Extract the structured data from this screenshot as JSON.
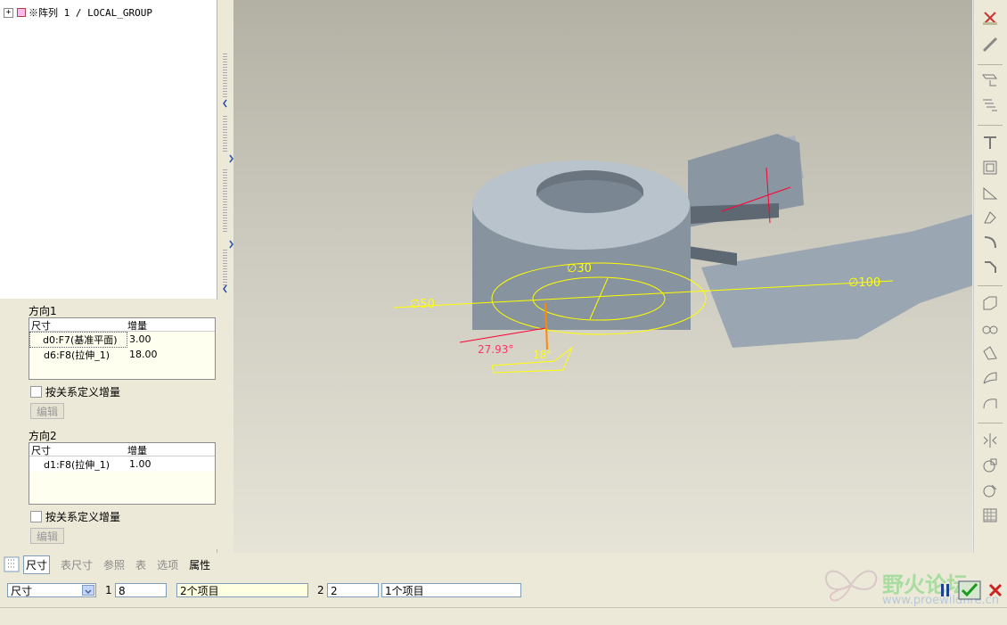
{
  "tree": {
    "items": [
      {
        "label": "※阵列 1 / LOCAL_GROUP"
      }
    ]
  },
  "panel": {
    "direction1": {
      "label": "方向1",
      "col_dim": "尺寸",
      "col_inc": "增量",
      "rows": [
        {
          "dim": "d0:F7(基准平面)",
          "inc": "3.00"
        },
        {
          "dim": "d6:F8(拉伸_1)",
          "inc": "18.00"
        }
      ],
      "relation_checkbox": "按关系定义增量",
      "edit_button": "编辑"
    },
    "direction2": {
      "label": "方向2",
      "col_dim": "尺寸",
      "col_inc": "增量",
      "rows": [
        {
          "dim": "d1:F8(拉伸_1)",
          "inc": "1.00"
        }
      ],
      "relation_checkbox": "按关系定义增量",
      "edit_button": "编辑"
    }
  },
  "tabs": [
    "尺寸",
    "表尺寸",
    "参照",
    "表",
    "选项",
    "属性"
  ],
  "dashboard": {
    "type_select": "尺寸",
    "dir1_label": "1",
    "dir1_count": "8",
    "dir1_items": "2个项目",
    "dir2_label": "2",
    "dir2_count": "2",
    "dir2_items": "1个项目"
  },
  "viewport": {
    "dims": {
      "d50": "∅50",
      "d30": "∅30",
      "d100": "∅100",
      "angle": "27.93°",
      "ang18": "18°"
    }
  },
  "watermark": {
    "title": "野火论坛",
    "url": "www.proewildfire.cn"
  },
  "colors": {
    "dim_yellow": "#ffff00",
    "model_gray": "#8e9aa6",
    "accent_red": "#ff0033"
  }
}
